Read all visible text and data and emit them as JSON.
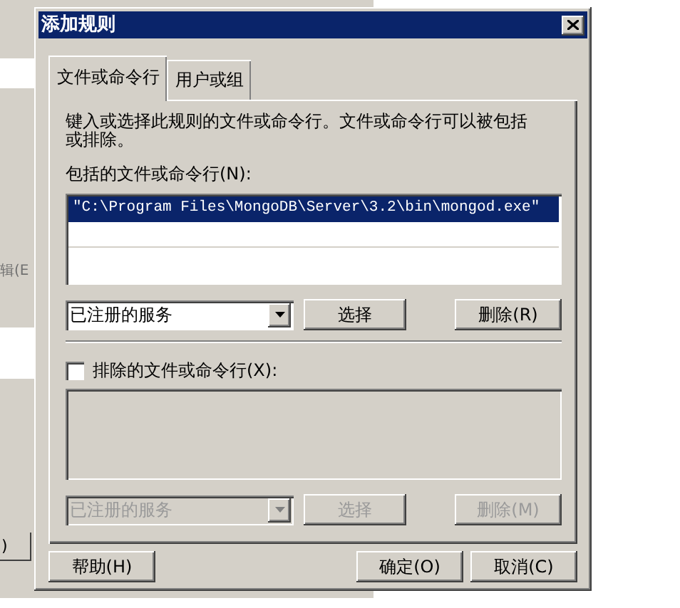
{
  "background_window": {
    "menu_label": "辑(E",
    "button_label": ")"
  },
  "dialog": {
    "title": "添加规则"
  },
  "tabs": [
    {
      "label": "文件或命令行",
      "selected": true
    },
    {
      "label": "用户或组",
      "selected": false
    }
  ],
  "description": "键入或选择此规则的文件或命令行。文件或命令行可以被包括或排除。",
  "include": {
    "label": "包括的文件或命令行(N):",
    "disabled": false,
    "items": [
      {
        "text": "\"C:\\Program Files\\MongoDB\\Server\\3.2\\bin\\mongod.exe\"",
        "selected": true
      }
    ],
    "combo_value": "已注册的服务",
    "browse": "选择",
    "remove": "删除(R)"
  },
  "exclude": {
    "label": "排除的文件或命令行(X):",
    "checked": false,
    "disabled": true,
    "combo_value": "已注册的服务",
    "browse": "选择",
    "remove": "删除(M)"
  },
  "buttons": {
    "help": "帮助(H)",
    "ok": "确定(O)",
    "cancel": "取消(C)"
  }
}
